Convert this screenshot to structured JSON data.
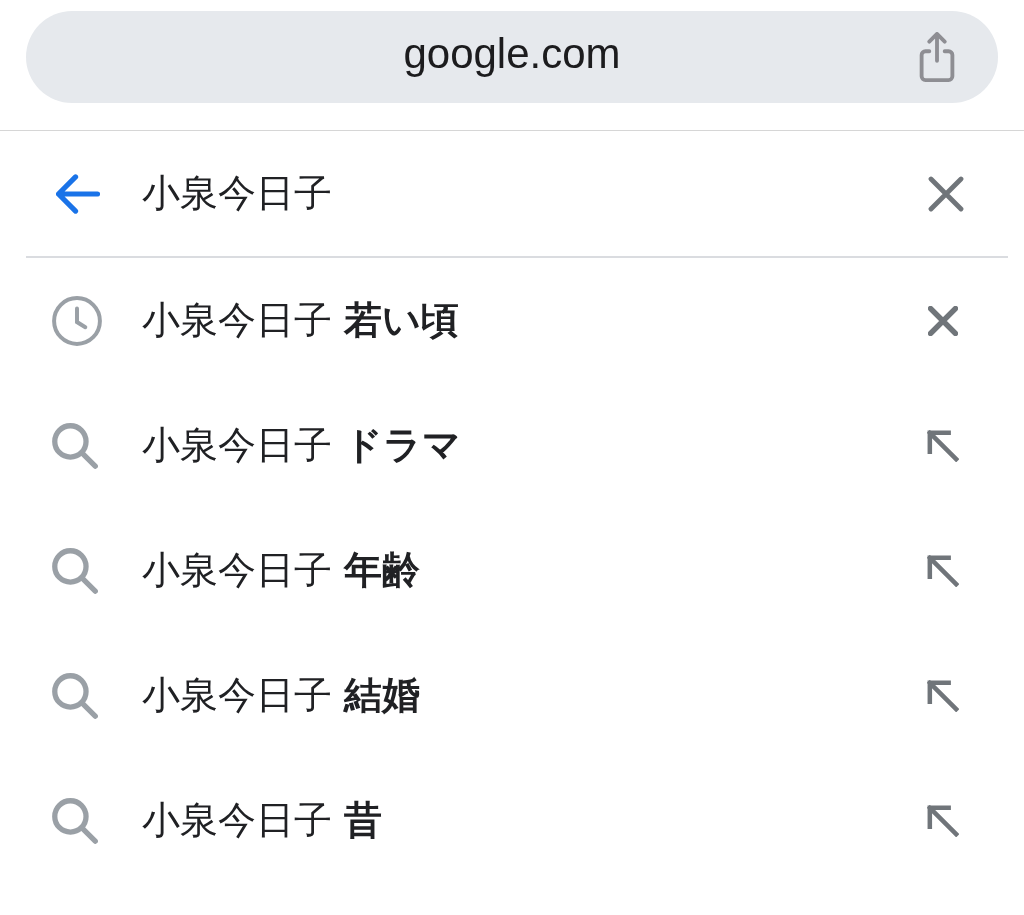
{
  "address_bar": {
    "url": "google.com"
  },
  "search": {
    "value": "小泉今日子"
  },
  "suggestions": [
    {
      "kind": "history",
      "text": "小泉今日子 **若い頃**"
    },
    {
      "kind": "search",
      "text": "小泉今日子 **ドラマ**"
    },
    {
      "kind": "search",
      "text": "小泉今日子 **年齢**"
    },
    {
      "kind": "search",
      "text": "小泉今日子 **結婚**"
    },
    {
      "kind": "search",
      "text": "小泉今日子 **昔**"
    }
  ]
}
